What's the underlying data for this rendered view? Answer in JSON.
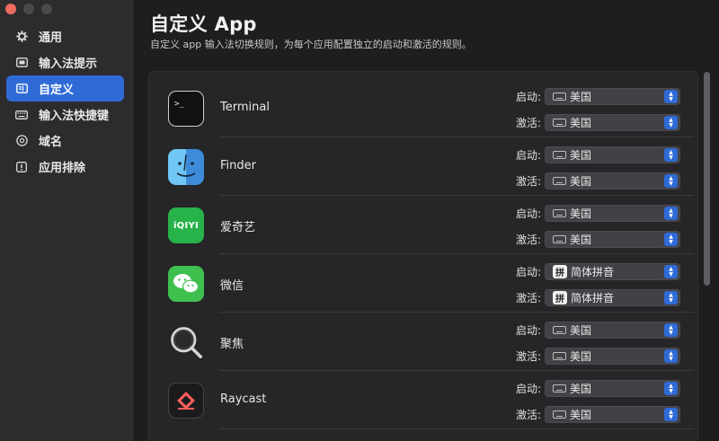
{
  "sidebar": {
    "items": [
      {
        "label": "通用",
        "icon": "gear-icon",
        "active": false
      },
      {
        "label": "输入法提示",
        "icon": "display-icon",
        "active": false
      },
      {
        "label": "自定义",
        "icon": "list-icon",
        "active": true
      },
      {
        "label": "输入法快捷键",
        "icon": "keyboard-icon",
        "active": false
      },
      {
        "label": "域名",
        "icon": "domain-icon",
        "active": false
      },
      {
        "label": "应用排除",
        "icon": "exclude-icon",
        "active": false
      }
    ]
  },
  "main": {
    "title": "自定义 App",
    "subtitle": "自定义 app 输入法切换规则，为每个应用配置独立的启动和激活的规则。"
  },
  "labels": {
    "launch": "启动:",
    "activate": "激活:"
  },
  "apps": [
    {
      "name": "Terminal",
      "icon": "terminal-icon",
      "launch": "美国",
      "activate": "美国",
      "launch_kind": "keyboard",
      "activate_kind": "keyboard"
    },
    {
      "name": "Finder",
      "icon": "finder-icon",
      "launch": "美国",
      "activate": "美国",
      "launch_kind": "keyboard",
      "activate_kind": "keyboard"
    },
    {
      "name": "爱奇艺",
      "icon": "iqiyi-icon",
      "icon_text": "iQIYI",
      "launch": "美国",
      "activate": "美国",
      "launch_kind": "keyboard",
      "activate_kind": "keyboard"
    },
    {
      "name": "微信",
      "icon": "wechat-icon",
      "launch": "简体拼音",
      "activate": "简体拼音",
      "launch_kind": "pinyin",
      "activate_kind": "pinyin"
    },
    {
      "name": "聚焦",
      "icon": "spotlight-icon",
      "launch": "美国",
      "activate": "美国",
      "launch_kind": "keyboard",
      "activate_kind": "keyboard"
    },
    {
      "name": "Raycast",
      "icon": "raycast-icon",
      "launch": "美国",
      "activate": "美国",
      "launch_kind": "keyboard",
      "activate_kind": "keyboard"
    }
  ],
  "pinyin_glyph": "拼",
  "colors": {
    "accent": "#2f6bd6",
    "close": "#ec6a5e"
  }
}
